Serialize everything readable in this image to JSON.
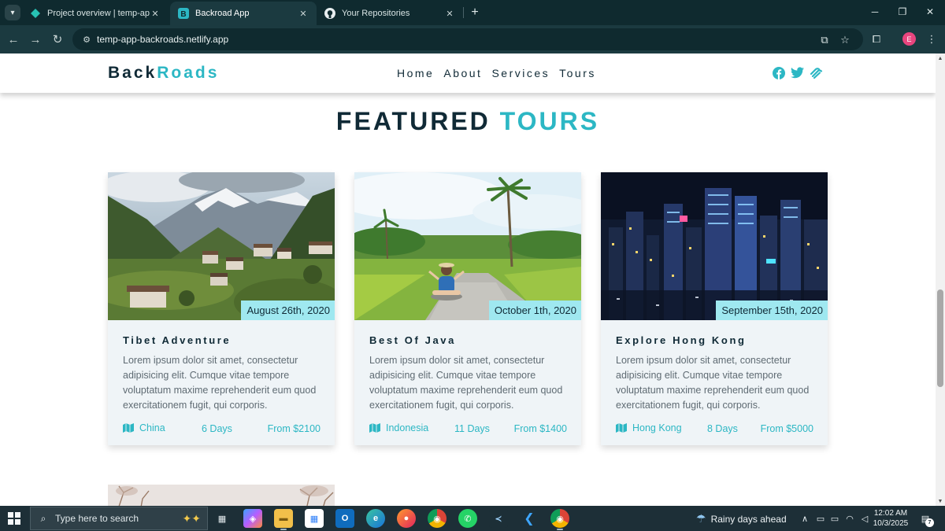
{
  "browser": {
    "tabs": [
      {
        "label": "Project overview | temp-app-ba",
        "icon": "netlify-diamond-icon",
        "active": false
      },
      {
        "label": "Backroad App",
        "icon": "backroads-b-icon",
        "active": true
      },
      {
        "label": "Your Repositories",
        "icon": "github-icon",
        "active": false
      }
    ],
    "url": "temp-app-backroads.netlify.app",
    "profile_initial": "E",
    "colors": {
      "tabbar": "#0f2a2f",
      "toolbar": "#1b3a40",
      "profile": "#e8457e"
    }
  },
  "site": {
    "logo": {
      "part1": "Back",
      "part2": "Roads"
    },
    "nav": [
      "Home",
      "About",
      "Services",
      "Tours"
    ],
    "socials": [
      "facebook-icon",
      "twitter-icon",
      "squarespace-icon"
    ],
    "section_title": {
      "part1": "FEATURED",
      "part2": "TOURS"
    },
    "colors": {
      "primary": "#2cb7c4",
      "dark": "#102a36",
      "badge": "#9fe8f0",
      "card": "#eff4f7"
    }
  },
  "tours": [
    {
      "date": "August 26th, 2020",
      "title": "Tibet Adventure",
      "description": "Lorem ipsum dolor sit amet, consectetur adipisicing elit. Cumque vitae tempore voluptatum maxime reprehenderit eum quod exercitationem fugit, qui corporis.",
      "country": "China",
      "days": "6 Days",
      "price": "From $2100"
    },
    {
      "date": "October 1th, 2020",
      "title": "Best Of Java",
      "description": "Lorem ipsum dolor sit amet, consectetur adipisicing elit. Cumque vitae tempore voluptatum maxime reprehenderit eum quod exercitationem fugit, qui corporis.",
      "country": "Indonesia",
      "days": "11 Days",
      "price": "From $1400"
    },
    {
      "date": "September 15th, 2020",
      "title": "Explore Hong Kong",
      "description": "Lorem ipsum dolor sit amet, consectetur adipisicing elit. Cumque vitae tempore voluptatum maxime reprehenderit eum quod exercitationem fugit, qui corporis.",
      "country": "Hong Kong",
      "days": "8 Days",
      "price": "From $5000"
    }
  ],
  "taskbar": {
    "search_placeholder": "Type here to search",
    "weather": "Rainy days ahead",
    "time": "12:02 AM",
    "date": "10/3/2025",
    "notification_count": "7"
  }
}
